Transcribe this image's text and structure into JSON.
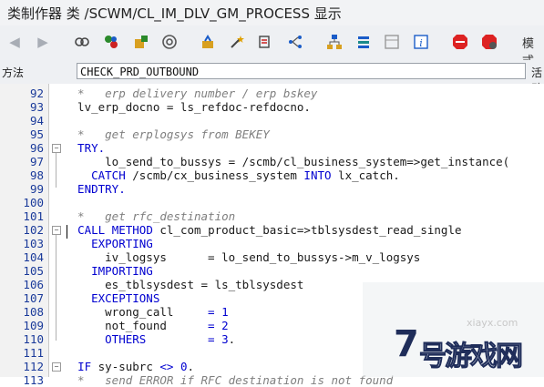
{
  "title": "类制作器 类 /SCWM/CL_IM_DLV_GM_PROCESS 显示",
  "toolbar": {
    "right_label": "模式",
    "icons": [
      "back-arrow-icon",
      "forward-arrow-icon",
      "display-change-icon",
      "activate-icon",
      "where-used-icon",
      "object-list-icon",
      "check-icon",
      "magic-wand-icon",
      "pretty-printer-icon",
      "tree-icon",
      "hierarchy-icon",
      "stack-icon",
      "frame-icon",
      "info-icon",
      "breakpoint-icon",
      "external-breakpoint-icon"
    ]
  },
  "method_bar": {
    "label": "方法",
    "value": "CHECK_PRD_OUTBOUND",
    "active_label": "活动"
  },
  "code": {
    "lines": [
      {
        "num": "92",
        "text": "  *   erp delivery number / erp bskey",
        "type": "comment"
      },
      {
        "num": "93",
        "text": "  lv_erp_docno = ls_refdoc-refdocno.",
        "type": "normal"
      },
      {
        "num": "94",
        "text": "",
        "type": "normal"
      },
      {
        "num": "95",
        "text": "  *   get erplogsys from BEKEY",
        "type": "comment"
      },
      {
        "num": "96",
        "text": "  TRY.",
        "type": "keyword"
      },
      {
        "num": "97",
        "text": "      lo_send_to_bussys = /scmb/cl_business_system=>get_instance(",
        "type": "normal"
      },
      {
        "num": "98",
        "text": "    CATCH /scmb/cx_business_system INTO lx_catch.",
        "type": "mixed_catch"
      },
      {
        "num": "99",
        "text": "  ENDTRY.",
        "type": "keyword"
      },
      {
        "num": "100",
        "text": "",
        "type": "normal"
      },
      {
        "num": "101",
        "text": "  *   get rfc_destination",
        "type": "comment"
      },
      {
        "num": "102",
        "text": "  CALL METHOD cl_com_product_basic=>tblsysdest_read_single",
        "type": "mixed_call"
      },
      {
        "num": "103",
        "text": "    EXPORTING",
        "type": "keyword"
      },
      {
        "num": "104",
        "text": "      iv_logsys      = lo_send_to_bussys->m_v_logsys",
        "type": "normal"
      },
      {
        "num": "105",
        "text": "    IMPORTING",
        "type": "keyword"
      },
      {
        "num": "106",
        "text": "      es_tblsysdest = ls_tblsysdest",
        "type": "normal"
      },
      {
        "num": "107",
        "text": "    EXCEPTIONS",
        "type": "keyword"
      },
      {
        "num": "108",
        "text": "      wrong_call     = 1",
        "type": "exc"
      },
      {
        "num": "109",
        "text": "      not_found      = 2",
        "type": "exc"
      },
      {
        "num": "110",
        "text": "      OTHERS         = 3.",
        "type": "exc"
      },
      {
        "num": "111",
        "text": "",
        "type": "normal"
      },
      {
        "num": "112",
        "text": "  IF sy-subrc <> 0.",
        "type": "mixed_if"
      },
      {
        "num": "113",
        "text": "  *   send ERROR if RFC destination is not found",
        "type": "comment"
      }
    ]
  },
  "watermark": {
    "sub": "xiayx.com",
    "logo_text": "7号游戏网"
  },
  "colors": {
    "keyword": "#0000d0",
    "comment": "#7f7f7f",
    "line_number": "#1a3a9a"
  }
}
